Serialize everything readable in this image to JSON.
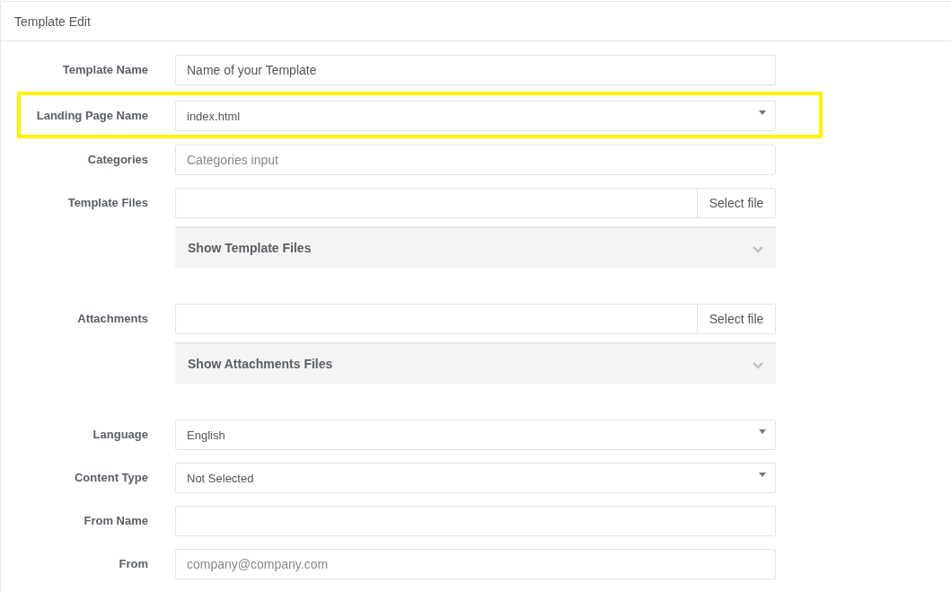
{
  "panel": {
    "title": "Template Edit"
  },
  "rows": [
    {
      "kind": "text",
      "label": "Template Name",
      "value": "Name of your Template",
      "highlighted": false
    },
    {
      "kind": "select",
      "label": "Landing Page Name",
      "value": "index.html",
      "highlighted": true
    },
    {
      "kind": "text",
      "label": "Categories",
      "placeholder": "Categories input",
      "highlighted": false
    },
    {
      "kind": "file",
      "label": "Template Files",
      "button": "Select file",
      "files_panel": {
        "title": "Show Template Files",
        "expanded": false
      },
      "highlighted": false
    },
    {
      "kind": "file",
      "label": "Attachments",
      "button": "Select file",
      "files_panel": {
        "title": "Show Attachments Files",
        "expanded": false
      },
      "highlighted": false
    },
    {
      "kind": "select",
      "label": "Language",
      "value": "English",
      "highlighted": false
    },
    {
      "kind": "select",
      "label": "Content Type",
      "value": "Not Selected",
      "highlighted": false
    },
    {
      "kind": "text",
      "label": "From Name",
      "highlighted": false
    },
    {
      "kind": "text",
      "label": "From",
      "placeholder": "company@company.com",
      "highlighted": false
    }
  ]
}
